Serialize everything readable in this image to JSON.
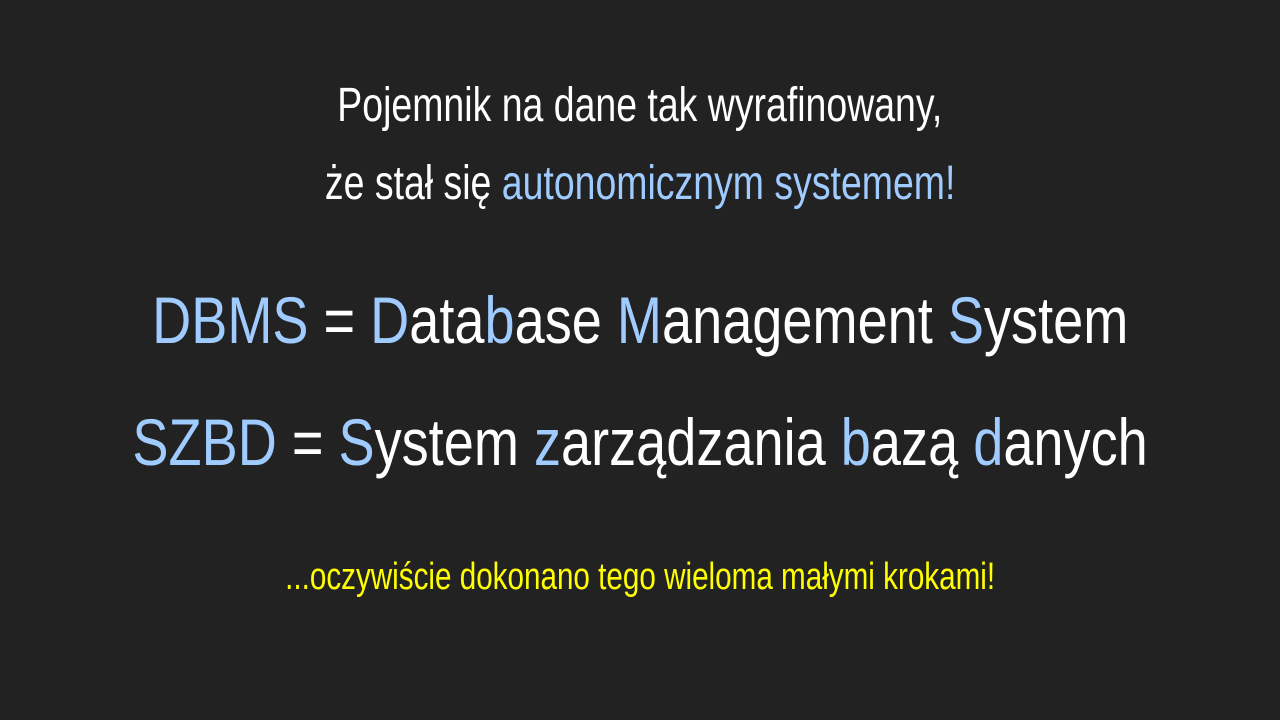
{
  "colors": {
    "background": "#222222",
    "text": "#ffffff",
    "accent": "#9fcbff",
    "note": "#ffff00"
  },
  "intro": {
    "line1": "Pojemnik na dane tak wyrafinowany,",
    "line2_prefix": "że stał się ",
    "line2_accent": "autonomicznym systemem!"
  },
  "dbms": {
    "acronym": "DBMS",
    "equals": " = ",
    "parts": [
      {
        "accent": "D",
        "rest": "ata"
      },
      {
        "accent": "b",
        "rest": "ase "
      },
      {
        "accent": "M",
        "rest": "anagement "
      },
      {
        "accent": "S",
        "rest": "ystem"
      }
    ]
  },
  "szbd": {
    "acronym": "SZBD",
    "equals": " = ",
    "parts": [
      {
        "accent": "S",
        "rest": "ystem "
      },
      {
        "accent": "z",
        "rest": "arządzania "
      },
      {
        "accent": "b",
        "rest": "azą "
      },
      {
        "accent": "d",
        "rest": "anych"
      }
    ]
  },
  "note": {
    "text": "...oczywiście dokonano tego wieloma małymi krokami!"
  }
}
